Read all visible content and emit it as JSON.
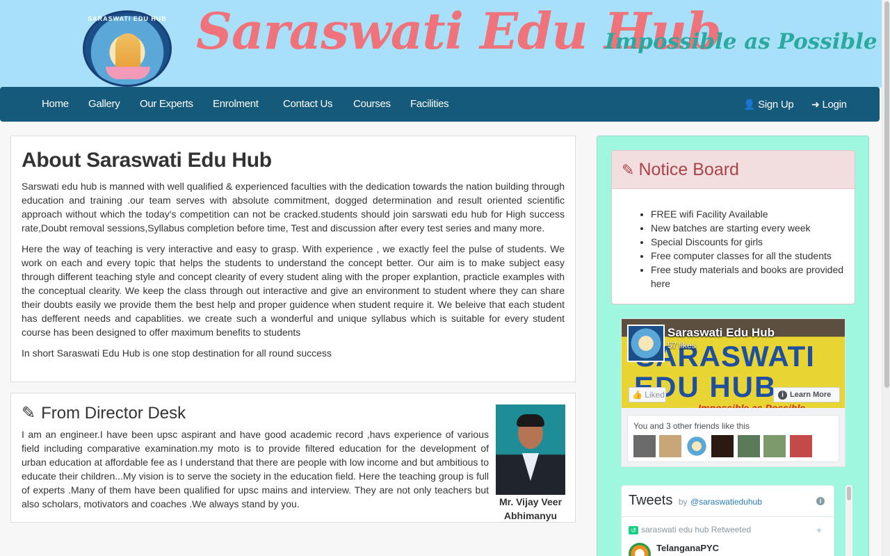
{
  "header": {
    "logo_text": "SARASWATI EDU HUB",
    "site_title": "Saraswati Edu Hub",
    "tagline": "Impossible as Possible ..."
  },
  "nav": {
    "items": [
      "Home",
      "Gallery",
      "Our Experts",
      "Enrolment",
      "Contact Us",
      "Courses",
      "Facilities"
    ],
    "signup": "Sign Up",
    "login": "Login"
  },
  "about": {
    "title": "About Saraswati Edu Hub",
    "paragraphs": [
      "Sarswati edu hub is manned with well qualified & experienced faculties with the dedication towards the nation building through education and training .our team serves with absolute commitment, dogged determination and result oriented scientific approach without which the today's competition can not be cracked.students should join sarswati edu hub for High success rate,Doubt removal sessions,Syllabus completion before time, Test and discussion after every test series and many more.",
      "Here the way of teaching is very interactive and easy to grasp. With experience , we exactly feel the pulse of students. We work on each and every topic that helps the students to understand the concept better. Our aim is to make subject easy through different teaching style and concept clearity of every student aling with the proper explantion, practicle examples with the conceptual clearity. We keep the class through out interactive and give an environment to student where they can share their doubts easily we provide them the best help and proper guidence when student require it. We beleive that each student has defferent needs and capablities. we create such a wonderful and unique syllabus which is suitable for every student course has been designed to offer maximum benefits to students",
      "In short Saraswati Edu Hub is one stop destination for all round success"
    ]
  },
  "director": {
    "title": "From Director Desk",
    "text": "I am an engineer.I have been upsc aspirant and have good academic record ,havs experience of various field including comparative examination.my moto is to provide filtered education for the development of urban education at affordable fee as I understand that there are people with low income and but ambitious to educate their children...My vision is to serve the society in the education field. Here the teaching group is full of experts .Many of them have been qualified for upsc mains and interview. They are not only teachers but also scholars, motivators and coaches .We always stand by you.",
    "name": "Mr. Vijay Veer Abhimanyu"
  },
  "notice_board": {
    "title": "Notice Board",
    "items": [
      "FREE wifi Facility Available",
      "New batches are starting every week",
      "Special Discounts for girls",
      "Free computer classes for all the students",
      "Free study materials and books are provided here"
    ]
  },
  "facebook": {
    "page_name": "Saraswati Edu Hub",
    "likes": "57 likes",
    "cover_line1": "SARASWATI",
    "cover_line2": "EDU HUB",
    "cover_tagline": "Impossible as Possible",
    "liked_label": "Liked",
    "learn_more": "Learn More",
    "friends_text": "You and 3 other friends like this"
  },
  "tweets": {
    "title": "Tweets",
    "by": "by",
    "handle": "@saraswatieduhub",
    "retweet_line": "saraswati edu hub Retweeted",
    "user": "TelanganaPYC"
  },
  "colors": {
    "header_bg": "#a7e0f8",
    "title": "#f0727a",
    "tagline": "#2aa9a0",
    "navbar": "#155a7a",
    "sidebar_bg": "#a0f7df",
    "notice_head": "#f2dedf",
    "notice_text": "#a9444a"
  }
}
